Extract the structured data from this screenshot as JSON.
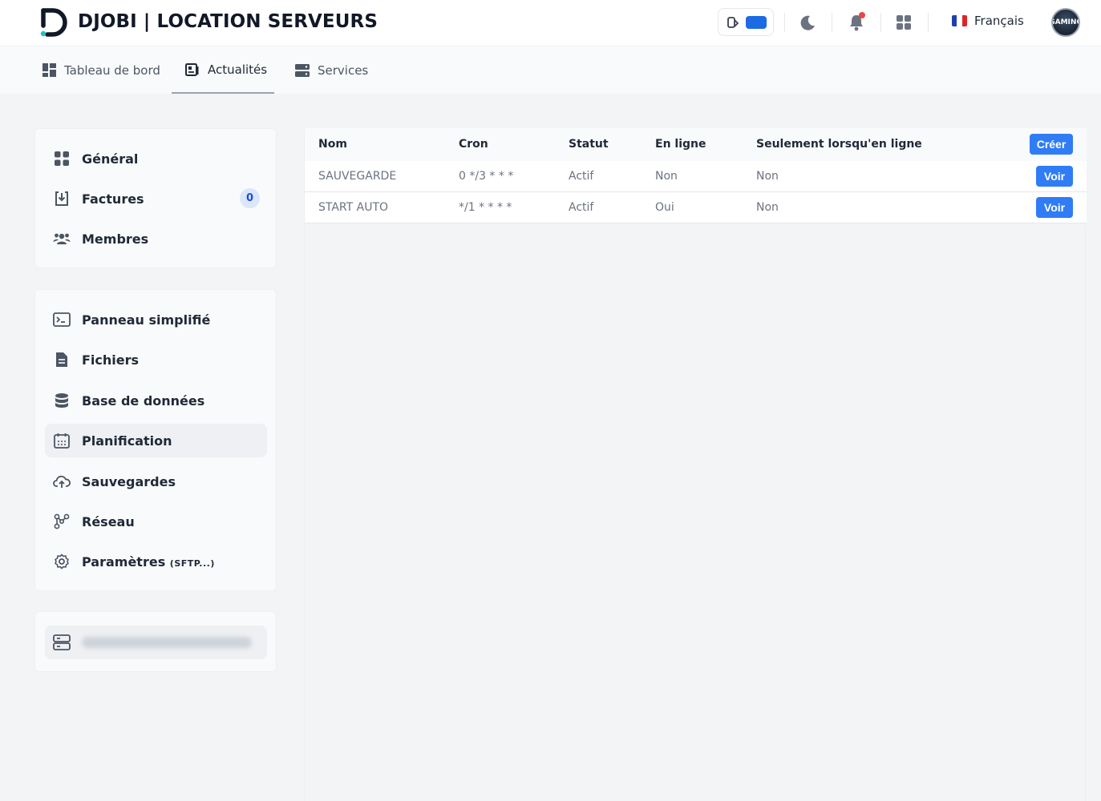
{
  "header": {
    "brand": "DJOBI | LOCATION SERVEURS",
    "language": "Français",
    "avatar_text": "GAMING"
  },
  "nav": {
    "tabs": [
      {
        "label": "Tableau de bord",
        "icon": "dashboard-icon"
      },
      {
        "label": "Actualités",
        "icon": "news-icon"
      },
      {
        "label": "Services",
        "icon": "server-icon"
      }
    ]
  },
  "sidebar": {
    "group1": [
      {
        "label": "Général",
        "icon": "grid-icon"
      },
      {
        "label": "Factures",
        "icon": "invoice-icon",
        "badge": "0"
      },
      {
        "label": "Membres",
        "icon": "users-icon"
      }
    ],
    "group2": [
      {
        "label": "Panneau simplifié",
        "icon": "terminal-icon"
      },
      {
        "label": "Fichiers",
        "icon": "file-icon"
      },
      {
        "label": "Base de données",
        "icon": "database-icon"
      },
      {
        "label": "Planification",
        "icon": "calendar-icon"
      },
      {
        "label": "Sauvegardes",
        "icon": "cloud-backup-icon"
      },
      {
        "label": "Réseau",
        "icon": "network-icon"
      },
      {
        "label": "Paramètres",
        "label_suffix": "(SFTP...)",
        "icon": "settings-icon"
      }
    ]
  },
  "table": {
    "columns": [
      "Nom",
      "Cron",
      "Statut",
      "En ligne",
      "Seulement lorsqu'en ligne"
    ],
    "create_label": "Créer",
    "view_label": "Voir",
    "rows": [
      [
        "SAUVEGARDE",
        "0 */3 * * *",
        "Actif",
        "Non",
        "Non"
      ],
      [
        "START AUTO",
        "*/1 * * * *",
        "Actif",
        "Oui",
        "Non"
      ]
    ]
  },
  "colors": {
    "accent": "#2f7cf6",
    "toggle": "#1d6ae5",
    "notification": "#ef4444"
  }
}
